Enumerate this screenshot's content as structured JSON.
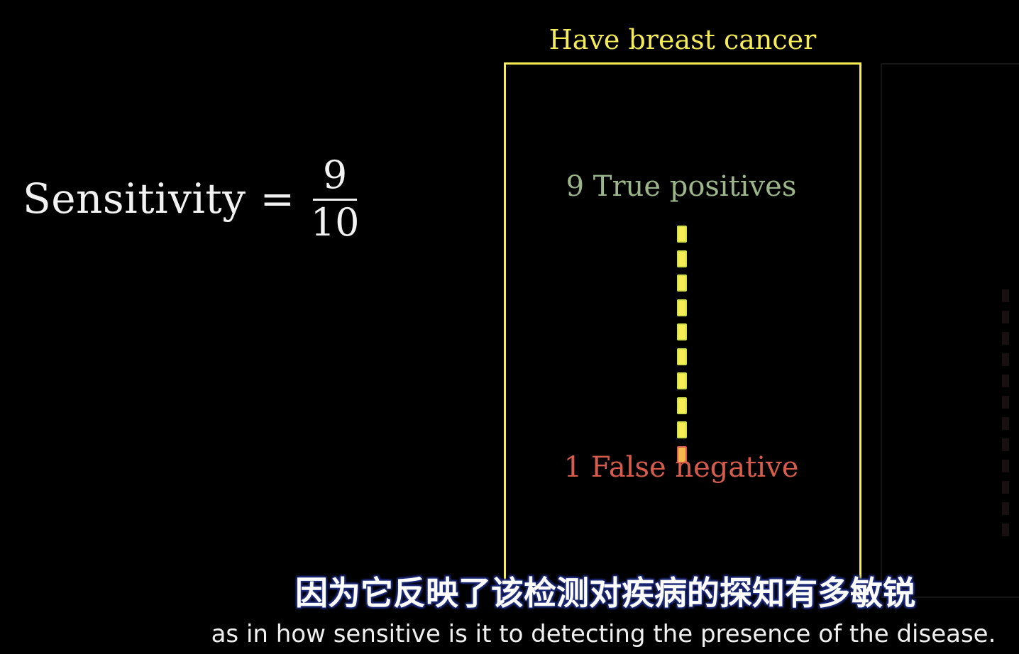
{
  "equation": {
    "label": "Sensitivity",
    "sign": "=",
    "numerator": "9",
    "denominator": "10"
  },
  "group": {
    "title": "Have breast cancer",
    "true_positives_label": "9 True positives",
    "false_negative_label": "1 False negative",
    "true_positive_count": 9,
    "false_negative_count": 1
  },
  "subtitles": {
    "chinese": "因为它反映了该检测对疾病的探知有多敏锐",
    "english": "as in how sensitive is it to detecting the presence of the disease."
  },
  "colors": {
    "background": "#000000",
    "group_box": "#f5ec58",
    "true_positive": "#9cb589",
    "false_negative": "#d85c4c"
  }
}
